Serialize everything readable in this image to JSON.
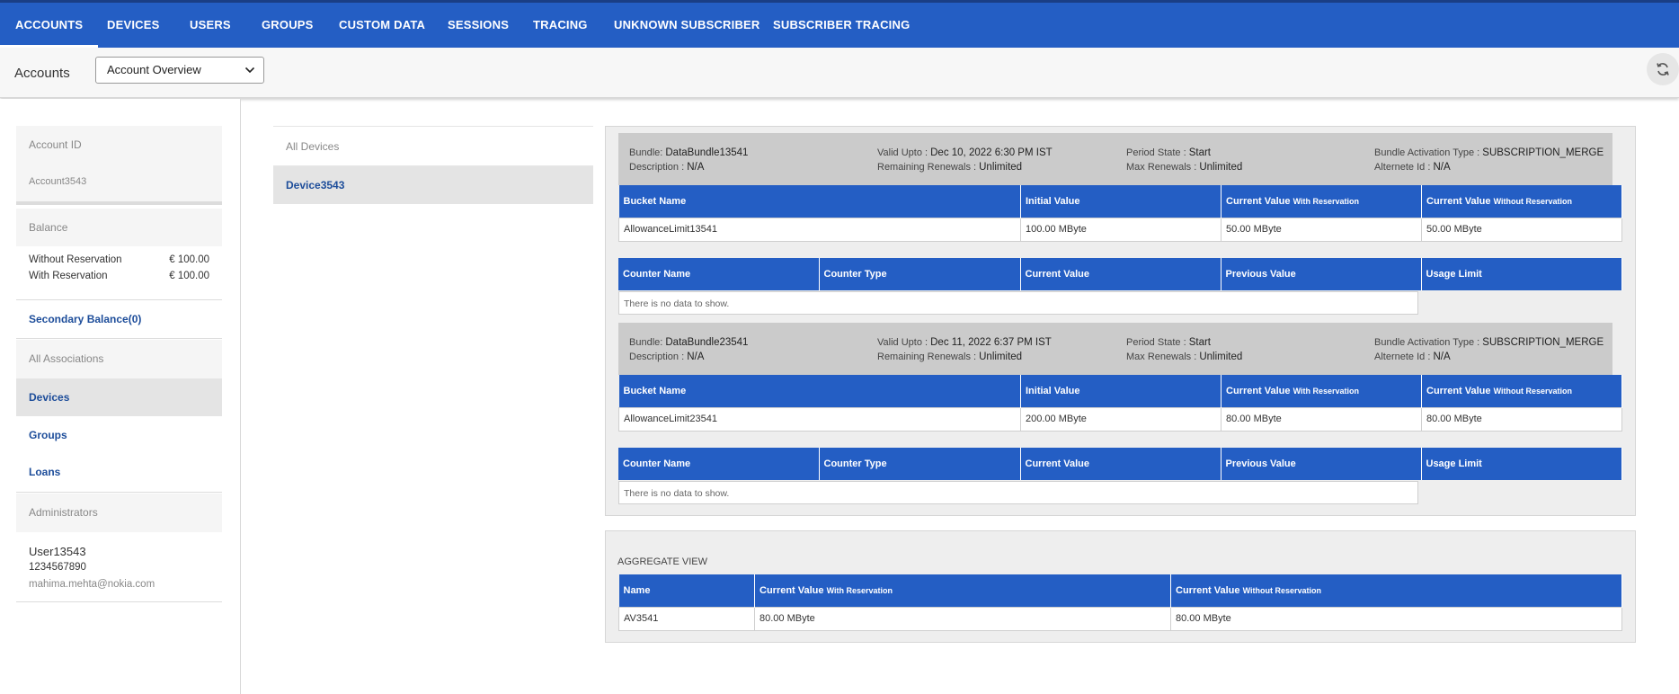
{
  "topnav": {
    "tabs": [
      "ACCOUNTS",
      "DEVICES",
      "USERS",
      "GROUPS",
      "CUSTOM DATA",
      "SESSIONS",
      "TRACING",
      "UNKNOWN SUBSCRIBER",
      "SUBSCRIBER TRACING"
    ],
    "active": "ACCOUNTS"
  },
  "subheader": {
    "breadcrumb": "Accounts",
    "view_select": "Account Overview"
  },
  "left": {
    "account_id_label": "Account ID",
    "account_id_value": "Account3543",
    "balance_label": "Balance",
    "without_reservation_label": "Without Reservation",
    "without_reservation_value": "€ 100.00",
    "with_reservation_label": "With Reservation",
    "with_reservation_value": "€ 100.00",
    "secondary_balance": "Secondary Balance(0)",
    "all_associations": "All Associations",
    "devices": "Devices",
    "groups": "Groups",
    "loans": "Loans",
    "administrators": "Administrators",
    "admin_name": "User13543",
    "admin_phone": "1234567890",
    "admin_email": "mahima.mehta@nokia.com"
  },
  "devices": {
    "header": "All Devices",
    "items": [
      "Device3543"
    ]
  },
  "bundles": [
    {
      "bundle_label": "Bundle:",
      "bundle_value": "DataBundle13541",
      "description_label": "Description :",
      "description_value": "N/A",
      "valid_label": "Valid Upto :",
      "valid_value": "Dec 10, 2022 6:30 PM IST",
      "renewals_label": "Remaining Renewals :",
      "renewals_value": "Unlimited",
      "period_label": "Period State :",
      "period_value": "Start",
      "max_label": "Max Renewals :",
      "max_value": "Unlimited",
      "activation_label": "Bundle Activation Type :",
      "activation_value": "SUBSCRIPTION_MERGE",
      "alternate_label": "Alternete Id :",
      "alternate_value": "N/A",
      "buckets": [
        {
          "name": "AllowanceLimit13541",
          "initial": "100.00 MByte",
          "with_res": "50.00 MByte",
          "without_res": "50.00 MByte"
        }
      ]
    },
    {
      "bundle_label": "Bundle:",
      "bundle_value": "DataBundle23541",
      "description_label": "Description :",
      "description_value": "N/A",
      "valid_label": "Valid Upto :",
      "valid_value": "Dec 11, 2022 6:37 PM IST",
      "renewals_label": "Remaining Renewals :",
      "renewals_value": "Unlimited",
      "period_label": "Period State :",
      "period_value": "Start",
      "max_label": "Max Renewals :",
      "max_value": "Unlimited",
      "activation_label": "Bundle Activation Type :",
      "activation_value": "SUBSCRIPTION_MERGE",
      "alternate_label": "Alternete Id :",
      "alternate_value": "N/A",
      "buckets": [
        {
          "name": "AllowanceLimit23541",
          "initial": "200.00 MByte",
          "with_res": "80.00 MByte",
          "without_res": "80.00 MByte"
        }
      ]
    }
  ],
  "bucket_headers": {
    "name": "Bucket Name",
    "initial": "Initial Value",
    "current": "Current Value",
    "with_res": "With Reservation",
    "without_res": "Without Reservation"
  },
  "counter_headers": {
    "name": "Counter Name",
    "type": "Counter Type",
    "current": "Current Value",
    "previous": "Previous Value",
    "usage": "Usage Limit"
  },
  "no_data": "There is no data to show.",
  "aggregate": {
    "title": "AGGREGATE VIEW",
    "headers": {
      "name": "Name",
      "current": "Current Value",
      "with_res": "With Reservation",
      "without_res": "Without Reservation"
    },
    "rows": [
      {
        "name": "AV3541",
        "with_res": "80.00 MByte",
        "without_res": "80.00 MByte"
      }
    ]
  },
  "colors": {
    "primary": "#245ec4",
    "link": "#1d4d9a",
    "bundle_bg": "#cbcbcb"
  },
  "icons": {
    "select": "chevron-down-icon",
    "refresh": "refresh-icon"
  }
}
